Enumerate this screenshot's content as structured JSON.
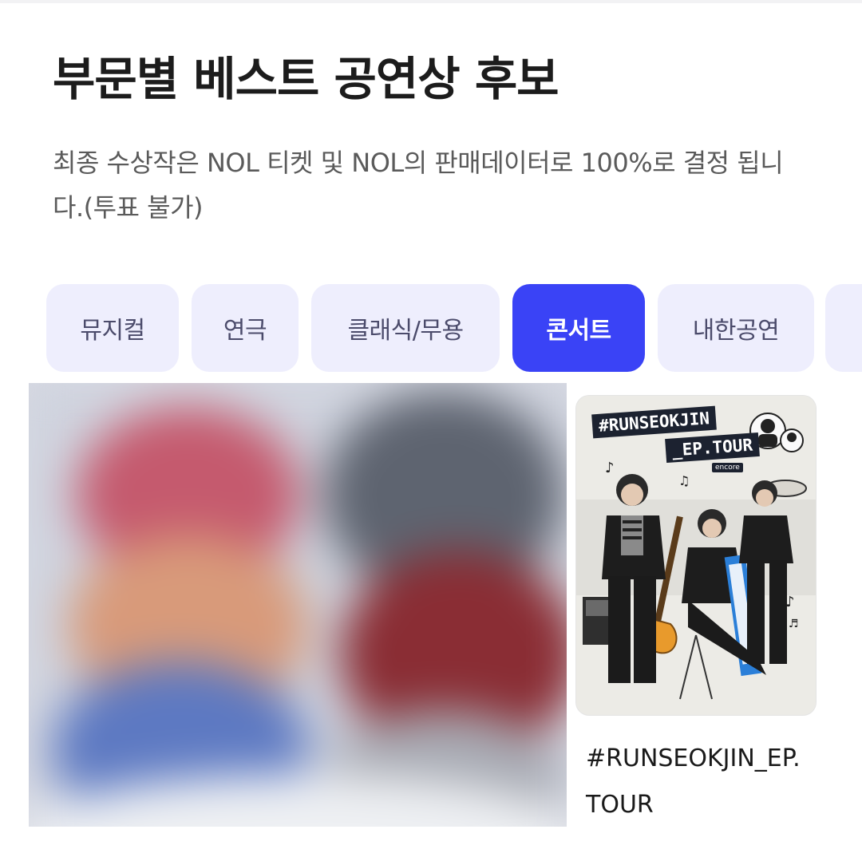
{
  "header": {
    "title": "부문별 베스트 공연상 후보",
    "description": "최종 수상작은 NOL 티켓 및 NOL의 판매데이터로 100%로 결정 됩니다.(투표 불가)"
  },
  "tabs": [
    {
      "label": "뮤지컬"
    },
    {
      "label": "연극"
    },
    {
      "label": "클래식/무용"
    },
    {
      "label": "콘서트",
      "active": true
    },
    {
      "label": "내한공연"
    }
  ],
  "items": [
    {
      "title": "#RUNSEOKJIN_EP.TOUR",
      "poster_title_line1": "#RUNSEOKJIN",
      "poster_title_line2": "_EP.TOUR",
      "poster_badge": "encore"
    }
  ],
  "colors": {
    "accent": "#3a43f6",
    "tab_bg": "#eeeefd",
    "tab_text": "#4b4b6b"
  }
}
